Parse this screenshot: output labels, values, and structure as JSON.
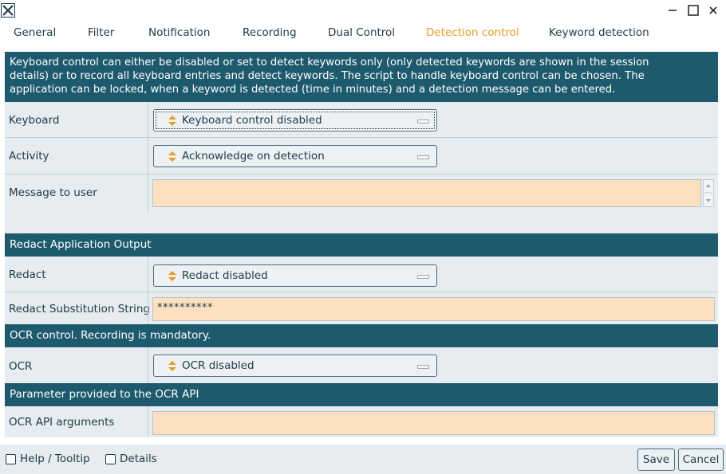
{
  "window": {
    "icons": {
      "app": "x-logo-icon",
      "minimize": "minimize-icon",
      "maximize": "maximize-icon",
      "close": "close-icon"
    }
  },
  "tabs": [
    {
      "label": "General"
    },
    {
      "label": "Filter"
    },
    {
      "label": "Notification"
    },
    {
      "label": "Recording"
    },
    {
      "label": "Dual Control"
    },
    {
      "label": "Detection control",
      "active": true
    },
    {
      "label": "Keyword detection"
    }
  ],
  "intro": {
    "lines": [
      "Keyboard control can either be disabled or set to detect keywords only (only detected keywords are shown in the session",
      "details) or to record all keyboard entries and detect keywords. The script to handle keyboard control can be chosen. The",
      "application can be locked, when a keyword is detected (time in minutes) and a detection message can be entered."
    ]
  },
  "keyboard": {
    "label": "Keyboard",
    "value": "Keyboard control disabled"
  },
  "activity": {
    "label": "Activity",
    "value": "Acknowledge on detection"
  },
  "message": {
    "label": "Message to user",
    "value": ""
  },
  "redact_section": {
    "title": "Redact Application Output"
  },
  "redact": {
    "label": "Redact",
    "value": "Redact disabled"
  },
  "redact_sub": {
    "label": "Redact Substitution String",
    "value": "**********"
  },
  "ocr_section": {
    "title": "OCR control. Recording is mandatory."
  },
  "ocr": {
    "label": "OCR",
    "value": "OCR disabled"
  },
  "ocr_param_section": {
    "title": "Parameter provided to the OCR API"
  },
  "ocr_args": {
    "label": "OCR API arguments",
    "value": ""
  },
  "footer": {
    "help_label": "Help / Tooltip",
    "details_label": "Details",
    "save_label": "Save",
    "cancel_label": "Cancel"
  },
  "colors": {
    "accent": "#e69c24",
    "header_bg": "#1e5a6e",
    "input_bg": "#fde0bf",
    "panel_bg": "#e6ecef",
    "text": "#1e3a4a"
  }
}
